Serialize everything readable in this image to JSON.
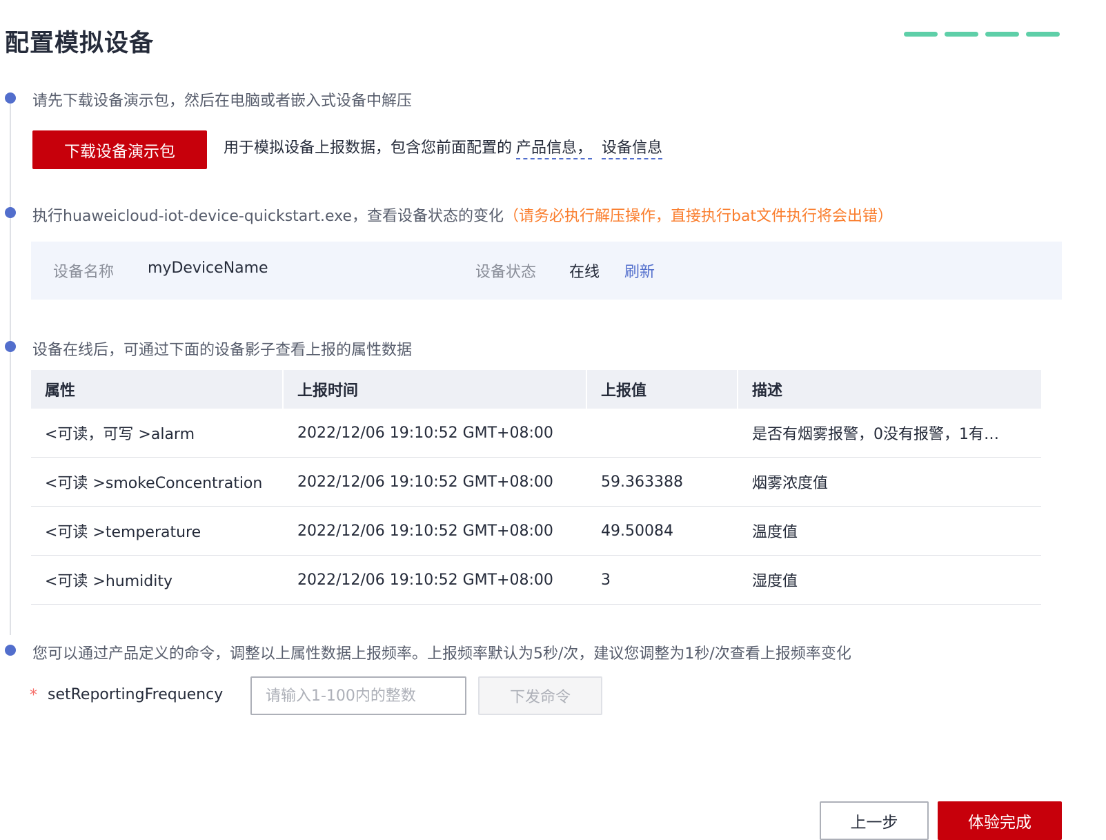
{
  "page": {
    "title": "配置模拟设备",
    "progress_steps": 4,
    "accent_color": "#5ecfa8",
    "brand_color": "#c7000b"
  },
  "step1": {
    "text": "请先下载设备演示包，然后在电脑或者嵌入式设备中解压",
    "download_button": "下载设备演示包",
    "desc_prefix": "用于模拟设备上报数据，包含您前面配置的",
    "link_product": "产品信息，",
    "link_device": "设备信息"
  },
  "step2": {
    "text": "执行huaweicloud-iot-device-quickstart.exe，查看设备状态的变化",
    "warning": "（请务必执行解压操作，直接执行bat文件执行将会出错）",
    "device_name_label": "设备名称",
    "device_name_value": "myDeviceName",
    "device_status_label": "设备状态",
    "device_status_value": "在线",
    "refresh_link": "刷新"
  },
  "step3": {
    "text": "设备在线后，可通过下面的设备影子查看上报的属性数据",
    "table": {
      "headers": [
        "属性",
        "上报时间",
        "上报值",
        "描述"
      ],
      "rows": [
        [
          "<可读，可写 >alarm",
          "2022/12/06 19:10:52 GMT+08:00",
          "",
          "是否有烟雾报警，0没有报警，1有…"
        ],
        [
          "<可读 >smokeConcentration",
          "2022/12/06 19:10:52 GMT+08:00",
          "59.363388",
          "烟雾浓度值"
        ],
        [
          "<可读 >temperature",
          "2022/12/06 19:10:52 GMT+08:00",
          "49.50084",
          "温度值"
        ],
        [
          "<可读 >humidity",
          "2022/12/06 19:10:52 GMT+08:00",
          "3",
          "湿度值"
        ]
      ]
    }
  },
  "step4": {
    "text": "您可以通过产品定义的命令，调整以上属性数据上报频率。上报频率默认为5秒/次，建议您调整为1秒/次查看上报频率变化",
    "required_mark": "*",
    "command_label": "setReportingFrequency",
    "input_value": "",
    "input_placeholder": "请输入1-100内的整数",
    "send_button": "下发命令"
  },
  "footer": {
    "prev_button": "上一步",
    "finish_button": "体验完成"
  }
}
